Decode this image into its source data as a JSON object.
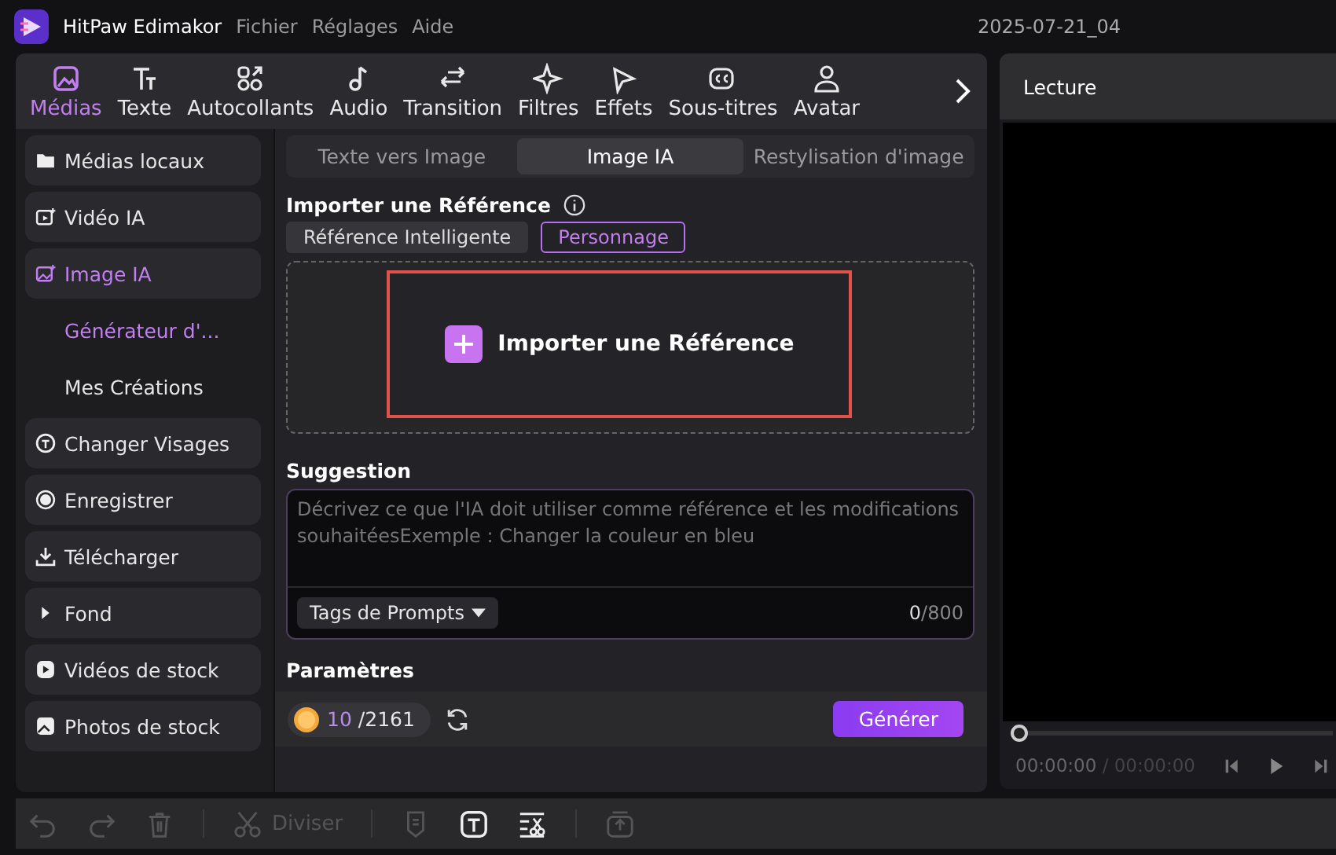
{
  "title_bar": {
    "app_name": "HitPaw Edimakor",
    "menu": [
      "Fichier",
      "Réglages",
      "Aide"
    ],
    "project": "2025-07-21_04"
  },
  "top_tabs": [
    {
      "label": "Médias",
      "selected": true
    },
    {
      "label": "Texte",
      "selected": false
    },
    {
      "label": "Autocollants",
      "selected": false
    },
    {
      "label": "Audio",
      "selected": false
    },
    {
      "label": "Transition",
      "selected": false
    },
    {
      "label": "Filtres",
      "selected": false
    },
    {
      "label": "Effets",
      "selected": false
    },
    {
      "label": "Sous-titres",
      "selected": false
    },
    {
      "label": "Avatar",
      "selected": false
    }
  ],
  "sidebar": {
    "items": [
      {
        "kind": "item",
        "label": "Médias locaux",
        "selected": false
      },
      {
        "kind": "item",
        "label": "Vidéo IA",
        "selected": false
      },
      {
        "kind": "item",
        "label": "Image IA",
        "selected": true
      },
      {
        "kind": "subitem",
        "label": "Générateur d'...",
        "selected": true
      },
      {
        "kind": "subitem",
        "label": "Mes Créations",
        "selected": false
      },
      {
        "kind": "item",
        "label": "Changer Visages",
        "selected": false
      },
      {
        "kind": "item",
        "label": "Enregistrer",
        "selected": false
      },
      {
        "kind": "item",
        "label": "Télécharger",
        "selected": false
      },
      {
        "kind": "item",
        "label": "Fond",
        "selected": false
      },
      {
        "kind": "item",
        "label": "Vidéos de stock",
        "selected": false
      },
      {
        "kind": "item",
        "label": "Photos de stock",
        "selected": false
      }
    ]
  },
  "mode_tabs": [
    {
      "label": "Texte vers Image",
      "selected": false
    },
    {
      "label": "Image IA",
      "selected": true
    },
    {
      "label": "Restylisation d'image",
      "selected": false
    }
  ],
  "reference": {
    "heading": "Importer une Référence",
    "tabs": [
      {
        "label": "Référence Intelligente",
        "selected": false
      },
      {
        "label": "Personnage",
        "selected": true
      }
    ],
    "drop_label": "Importer une Référence"
  },
  "suggestion": {
    "heading": "Suggestion",
    "placeholder": "Décrivez ce que l'IA doit utiliser comme référence et les modifications souhaitéesExemple : Changer la couleur en bleu",
    "tags_button": "Tags de Prompts",
    "count": "0",
    "max": "/800"
  },
  "parameters": {
    "heading": "Paramètres",
    "credits_used": "10",
    "credits_total": "/2161",
    "generate": "Générer"
  },
  "preview": {
    "title": "Lecture",
    "level": 0,
    "time": "00:00:00",
    "duration": "/ 00:00:00"
  },
  "toolbar": {
    "split": "Diviser"
  }
}
